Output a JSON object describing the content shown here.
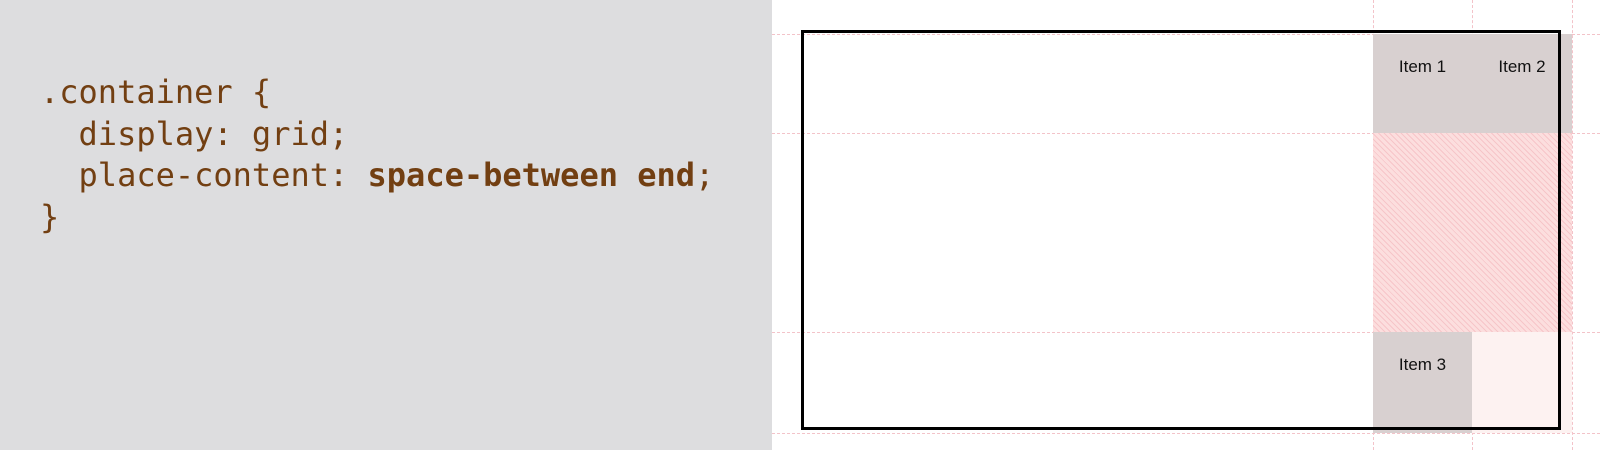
{
  "code": {
    "selector": ".container {",
    "line_display": "  display: grid;",
    "line_place_prop": "  place-content: ",
    "line_place_value": "space-between end",
    "line_place_end": ";",
    "closing": "}"
  },
  "demo": {
    "items": [
      {
        "label": "Item 1"
      },
      {
        "label": "Item 2"
      },
      {
        "label": "Item 3"
      }
    ]
  }
}
